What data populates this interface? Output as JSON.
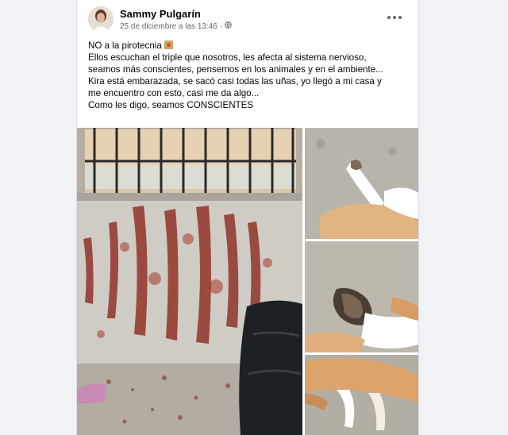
{
  "post": {
    "author": "Sammy Pulgarín",
    "timestamp": "25 de diciembre a las 13:46",
    "separator": "·",
    "lines": [
      "NO a la pirotecnia",
      "Ellos escuchan el triple que nosotros, les afecta al sistema nervioso,",
      "seamos más conscientes, pensemos en los animales y en el ambiente...",
      "Kira está embarazada, se sacó casi todas las uñas, yo llegó a mi casa y",
      "me encuentro con esto, casi me da algo...",
      "Como les digo, seamos CONSCIENTES"
    ]
  },
  "icons": {
    "privacy": "globe-icon",
    "menu": "more-options-icon",
    "emoji": "fireworks-emoji-icon"
  },
  "colors": {
    "author": "#050505",
    "meta": "#65676b",
    "blood": "#8a1f14"
  }
}
